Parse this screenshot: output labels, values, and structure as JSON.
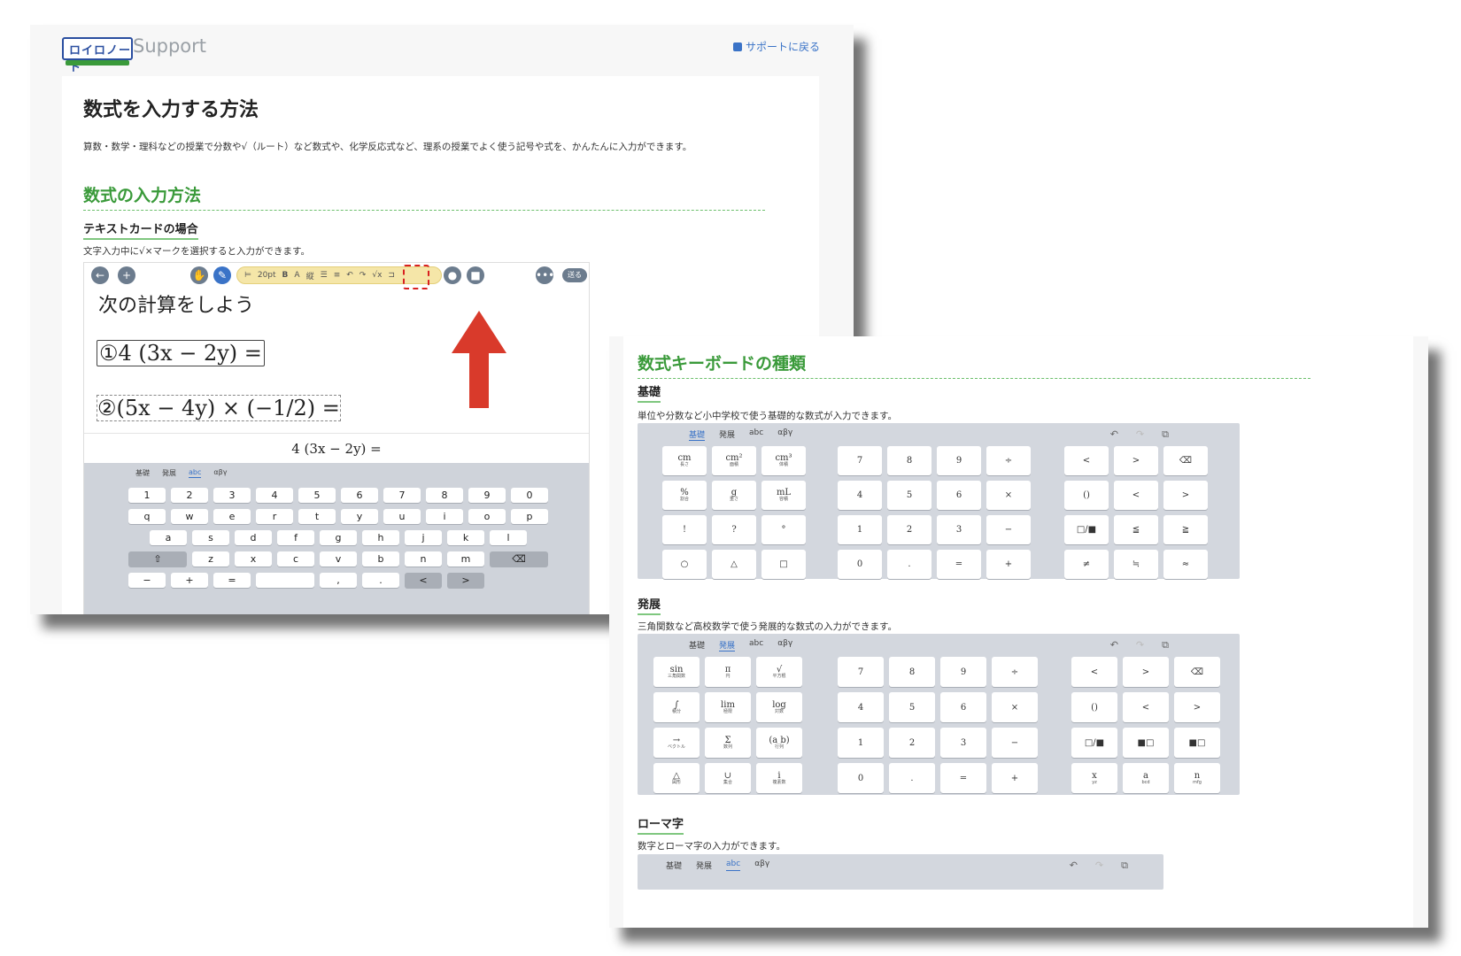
{
  "site": {
    "logo_text": "ロイロノート",
    "support": "Support",
    "back_link": "サポートに戻る"
  },
  "page": {
    "title": "数式を入力する方法",
    "lead": "算数・数学・理科などの授業で分数や√（ルート）など数式や、化学反応式など、理系の授業でよく使う記号や式を、かんたんに入力ができます。",
    "section1": "数式の入力方法",
    "sub1": "テキストカードの場合",
    "sub1_desc": "文字入力中に√×マークを選択すると入力ができます。"
  },
  "editor": {
    "toolbar": {
      "font_size": "20pt",
      "bold": "B",
      "send": "送る",
      "more": "•••"
    },
    "task": "次の計算をしよう",
    "expr1": "①4 (3x − 2y) =",
    "expr2": "②(5x − 4y) × (−1/2) =",
    "preview": "4 (3x − 2y) =",
    "kb_tabs": [
      "基礎",
      "発展",
      "abc",
      "αβγ"
    ],
    "rows": [
      [
        "1",
        "2",
        "3",
        "4",
        "5",
        "6",
        "7",
        "8",
        "9",
        "0"
      ],
      [
        "q",
        "w",
        "e",
        "r",
        "t",
        "y",
        "u",
        "i",
        "o",
        "p"
      ],
      [
        "a",
        "s",
        "d",
        "f",
        "g",
        "h",
        "j",
        "k",
        "l"
      ],
      [
        "⇧",
        "z",
        "x",
        "c",
        "v",
        "b",
        "n",
        "m",
        "⌫"
      ],
      [
        "−",
        "+",
        "=",
        "",
        ",",
        ".",
        "<",
        ">"
      ]
    ]
  },
  "section2": {
    "title": "数式キーボードの種類",
    "basic": {
      "heading": "基礎",
      "desc": "単位や分数など小中学校で使う基礎的な数式が入力できます。",
      "tabs": [
        "基礎",
        "発展",
        "abc",
        "αβγ"
      ],
      "left": [
        [
          "cm",
          "長さ"
        ],
        [
          "cm²",
          "面積"
        ],
        [
          "cm³",
          "体積"
        ],
        [
          "%",
          "割合"
        ],
        [
          "g",
          "重さ"
        ],
        [
          "mL",
          "容積"
        ],
        [
          "!",
          ""
        ],
        [
          "?",
          ""
        ],
        [
          "°",
          ""
        ],
        [
          "○",
          ""
        ],
        [
          "△",
          ""
        ],
        [
          "□",
          ""
        ]
      ],
      "mid": [
        "7",
        "8",
        "9",
        "÷",
        "4",
        "5",
        "6",
        "×",
        "1",
        "2",
        "3",
        "−",
        "0",
        ".",
        "=",
        "+"
      ],
      "right": [
        "<",
        ">",
        "⌫",
        "()",
        "<",
        ">",
        "□/■",
        "≦",
        "≧",
        "≠",
        "≒",
        "≈"
      ]
    },
    "advanced": {
      "heading": "発展",
      "desc": "三角関数など高校数学で使う発展的な数式の入力ができます。",
      "tabs": [
        "基礎",
        "発展",
        "abc",
        "αβγ"
      ],
      "left": [
        [
          "sin",
          "三角関数"
        ],
        [
          "π",
          "円"
        ],
        [
          "√",
          "平方根"
        ],
        [
          "∫",
          "積分"
        ],
        [
          "lim",
          "極限"
        ],
        [
          "log",
          "対数"
        ],
        [
          "→",
          "ベクトル"
        ],
        [
          "Σ",
          "数列"
        ],
        [
          "(a b)",
          "行列"
        ],
        [
          "△",
          "図形"
        ],
        [
          "∪",
          "集合"
        ],
        [
          "i",
          "複素数"
        ]
      ],
      "mid": [
        "7",
        "8",
        "9",
        "÷",
        "4",
        "5",
        "6",
        "×",
        "1",
        "2",
        "3",
        "−",
        "0",
        ".",
        "=",
        "+"
      ],
      "right": [
        [
          "<",
          ""
        ],
        [
          ">",
          ""
        ],
        [
          "⌫",
          ""
        ],
        [
          "()",
          ""
        ],
        [
          "<",
          ""
        ],
        [
          ">",
          ""
        ],
        [
          "□/■",
          ""
        ],
        [
          "■□",
          ""
        ],
        [
          "■□",
          ""
        ],
        [
          "x",
          "yz"
        ],
        [
          "a",
          "bcd"
        ],
        [
          "n",
          "mfg"
        ]
      ]
    },
    "roman": {
      "heading": "ローマ字",
      "desc": "数字とローマ字の入力ができます。",
      "tabs": [
        "基礎",
        "発展",
        "abc",
        "αβγ"
      ]
    }
  }
}
